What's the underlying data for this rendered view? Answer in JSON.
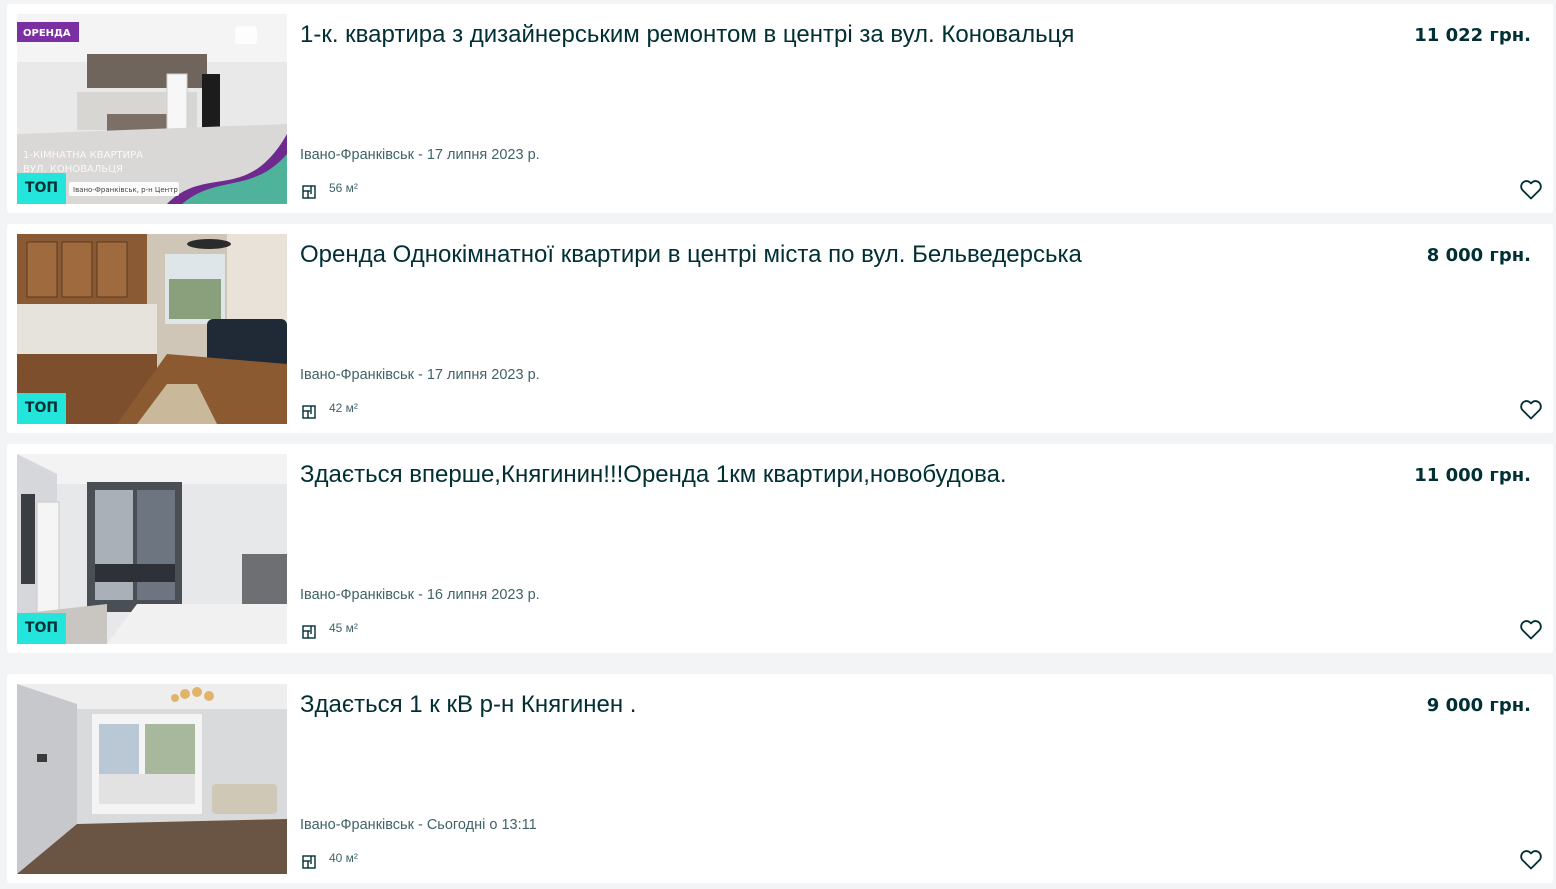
{
  "listings": [
    {
      "title": "1-к. квартира з дизайнерським ремонтом в центрі за вул. Коновальця",
      "price": "11 022 грн.",
      "location_date": "Івано-Франківськ - 17 липня 2023 р.",
      "area": "56 м²",
      "badge": "ТОП",
      "image_overlay": {
        "label": "ОРЕНДА",
        "caption_line1": "1-КІМНАТНА КВАРТИРА",
        "caption_line2": "ВУЛ. КОНОВАЛЬЦЯ",
        "caption_line3": "Івано-Франківськ, р-н Центр"
      }
    },
    {
      "title": "Оренда Однокімнатної квартири в центрі міста по вул. Бельведерська",
      "price": "8 000 грн.",
      "location_date": "Івано-Франківськ - 17 липня 2023 р.",
      "area": "42 м²",
      "badge": "ТОП"
    },
    {
      "title": "Здається вперше,Княгинин!!!Оренда 1км квартири,новобудова.",
      "price": "11 000 грн.",
      "location_date": "Івано-Франківськ - 16 липня 2023 р.",
      "area": "45 м²",
      "badge": "ТОП"
    },
    {
      "title": "Здається 1 к кВ р-н Княгинен .",
      "price": "9 000 грн.",
      "location_date": "Івано-Франківськ - Сьогодні о 13:11",
      "area": "40 м²"
    }
  ],
  "colors": {
    "text_dark": "#002f34",
    "text_muted": "#406367",
    "badge_bg": "#23e5db",
    "page_bg": "#f2f4f5",
    "card_bg": "#ffffff",
    "overlay_label_bg": "#7a2fa3"
  },
  "icons": {
    "area": "floorplan-icon",
    "favorite": "heart-outline-icon"
  }
}
